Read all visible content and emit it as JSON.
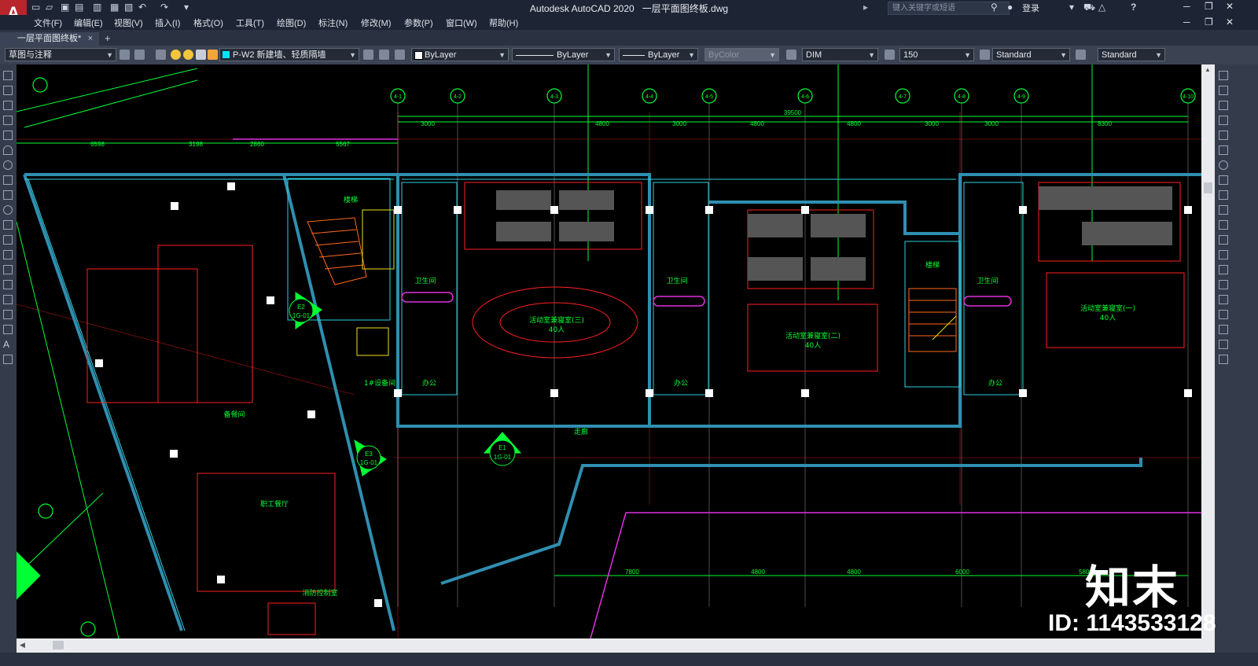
{
  "app": {
    "logo_letter": "A",
    "title": "Autodesk AutoCAD 2020",
    "file_name": "一层平面图终板.dwg",
    "search_placeholder": "键入关键字或短语",
    "login_label": "登录",
    "help_label": "?"
  },
  "menu": [
    {
      "label": "文件(F)"
    },
    {
      "label": "编辑(E)"
    },
    {
      "label": "视图(V)"
    },
    {
      "label": "插入(I)"
    },
    {
      "label": "格式(O)"
    },
    {
      "label": "工具(T)"
    },
    {
      "label": "绘图(D)"
    },
    {
      "label": "标注(N)"
    },
    {
      "label": "修改(M)"
    },
    {
      "label": "参数(P)"
    },
    {
      "label": "窗口(W)"
    },
    {
      "label": "帮助(H)"
    }
  ],
  "tabs": [
    {
      "label": "一层平面图终板*",
      "close": "×"
    }
  ],
  "new_tab_symbol": "+",
  "toolbar": {
    "workspace": "草图与注释",
    "layer": "P-W2 新建墙、轻质隔墙",
    "color": "ByLayer",
    "linetype": "ByLayer",
    "lineweight": "ByLayer",
    "plotstyle": "ByColor",
    "dimstyle": "DIM",
    "scale": "150",
    "textstyle": "Standard",
    "tablestyle": "Standard"
  },
  "drawing": {
    "grid_bubbles": [
      "4-1",
      "4-2",
      "4-3",
      "4-4",
      "4-5",
      "4-6",
      "4-7",
      "4-8",
      "4-9",
      "4-10"
    ],
    "top_dims": [
      "3000",
      "4800",
      "3000",
      "4800",
      "4800",
      "3000",
      "3000",
      "8300"
    ],
    "overall_dim": "39500",
    "left_dims": [
      "6598",
      "3198",
      "2860",
      "5567"
    ],
    "bottom_dims": [
      "7800",
      "4800",
      "4800",
      "6000",
      "5800"
    ],
    "rooms": [
      {
        "label": "楼梯"
      },
      {
        "label": "卫生间"
      },
      {
        "label": "活动室兼寝室(三)"
      },
      {
        "label": "40人"
      },
      {
        "label": "卫生间"
      },
      {
        "label": "活动室兼寝室(二)"
      },
      {
        "label": "40人"
      },
      {
        "label": "楼梯"
      },
      {
        "label": "卫生间"
      },
      {
        "label": "活动室兼寝室(一)"
      },
      {
        "label": "40人"
      },
      {
        "label": "办公"
      },
      {
        "label": "办公"
      },
      {
        "label": "办公"
      },
      {
        "label": "1#设备间"
      },
      {
        "label": "备餐间"
      },
      {
        "label": "走廊"
      },
      {
        "label": "职工餐厅"
      },
      {
        "label": "消防控制室"
      }
    ],
    "elevation_markers": [
      {
        "top": "E2",
        "bottom": "1G-01"
      },
      {
        "top": "E3",
        "bottom": "1G-01"
      },
      {
        "top": "E1",
        "bottom": "1G-01"
      }
    ]
  },
  "watermark": {
    "logo": "知末",
    "id": "ID: 1143533128"
  },
  "colors": {
    "canvas": "#000000",
    "chrome": "#1d2433",
    "toolbar": "#3b4353",
    "walls": "#2f8fb0",
    "furniture": "#ff2020",
    "dims": "#00ff33"
  }
}
